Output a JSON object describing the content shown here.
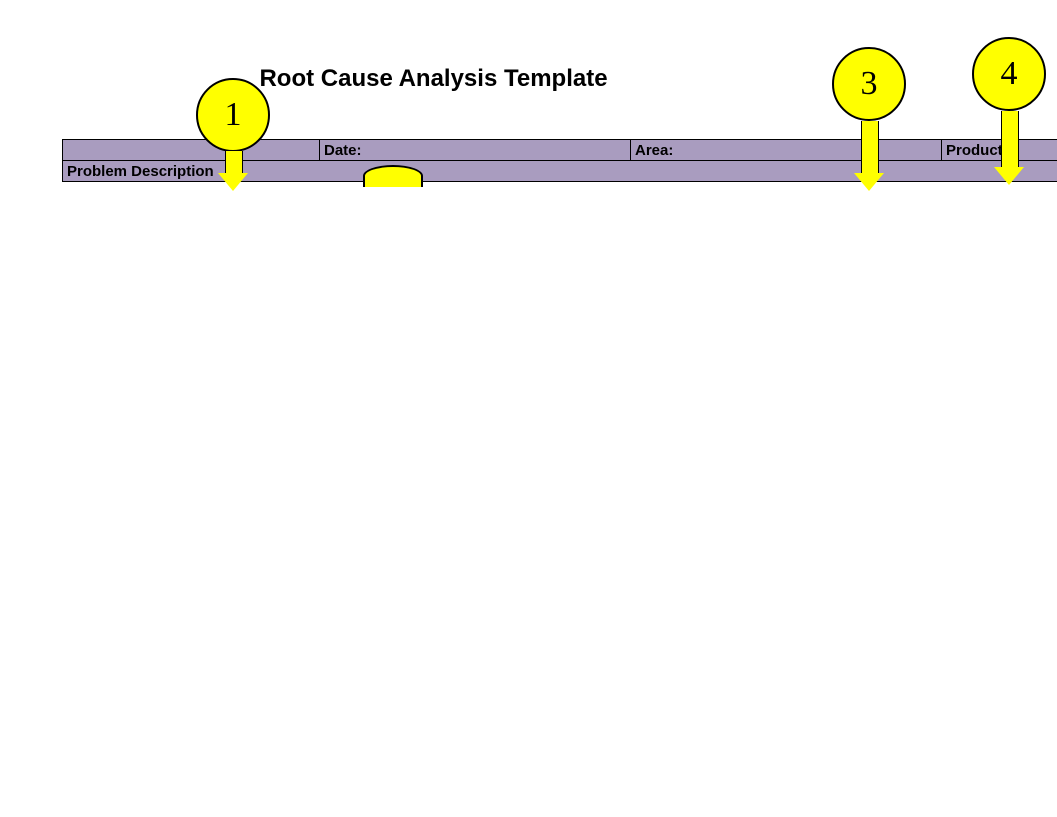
{
  "title": "Root Cause Analysis Template",
  "row1": {
    "cell1": "",
    "cell2": "Date:",
    "cell3": "Area:",
    "cell4": "Product/P"
  },
  "row2": {
    "label": "Problem Description"
  },
  "callouts": {
    "c1": "1",
    "c3": "3",
    "c4": "4"
  }
}
